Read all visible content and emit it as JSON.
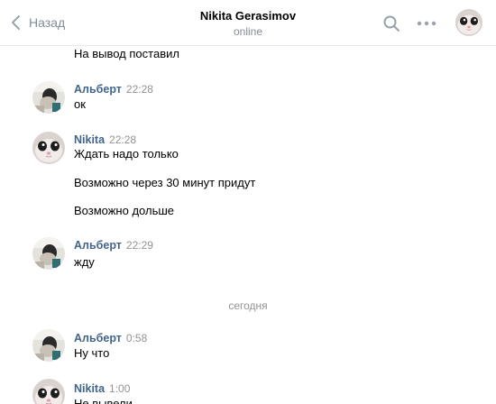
{
  "header": {
    "back_label": "Назад",
    "title": "Nikita Gerasimov",
    "status": "online"
  },
  "messages": [
    {
      "author": "",
      "time": "",
      "text": "На вывод поставил"
    },
    {
      "author": "Альберт",
      "time": "22:28",
      "text": "ок"
    },
    {
      "author": "Nikita",
      "time": "22:28",
      "text": "Ждать надо только"
    },
    {
      "author": "",
      "time": "",
      "text": "Возможно через 30 минут придут"
    },
    {
      "author": "",
      "time": "",
      "text": "Возможно дольше"
    },
    {
      "author": "Альберт",
      "time": "22:29",
      "text": "жду"
    },
    {
      "author": "Альберт",
      "time": "0:58",
      "text": "Ну что"
    },
    {
      "author": "Nikita",
      "time": "1:00",
      "text": "Не вывели"
    }
  ],
  "date_divider": "сегодня",
  "colors": {
    "author_link": "#42648b",
    "muted": "#818c99",
    "time": "#939393",
    "divider": "#e7e8ec"
  },
  "icons": {
    "back": "chevron-left-icon",
    "search": "search-icon",
    "more": "more-dots-icon"
  }
}
